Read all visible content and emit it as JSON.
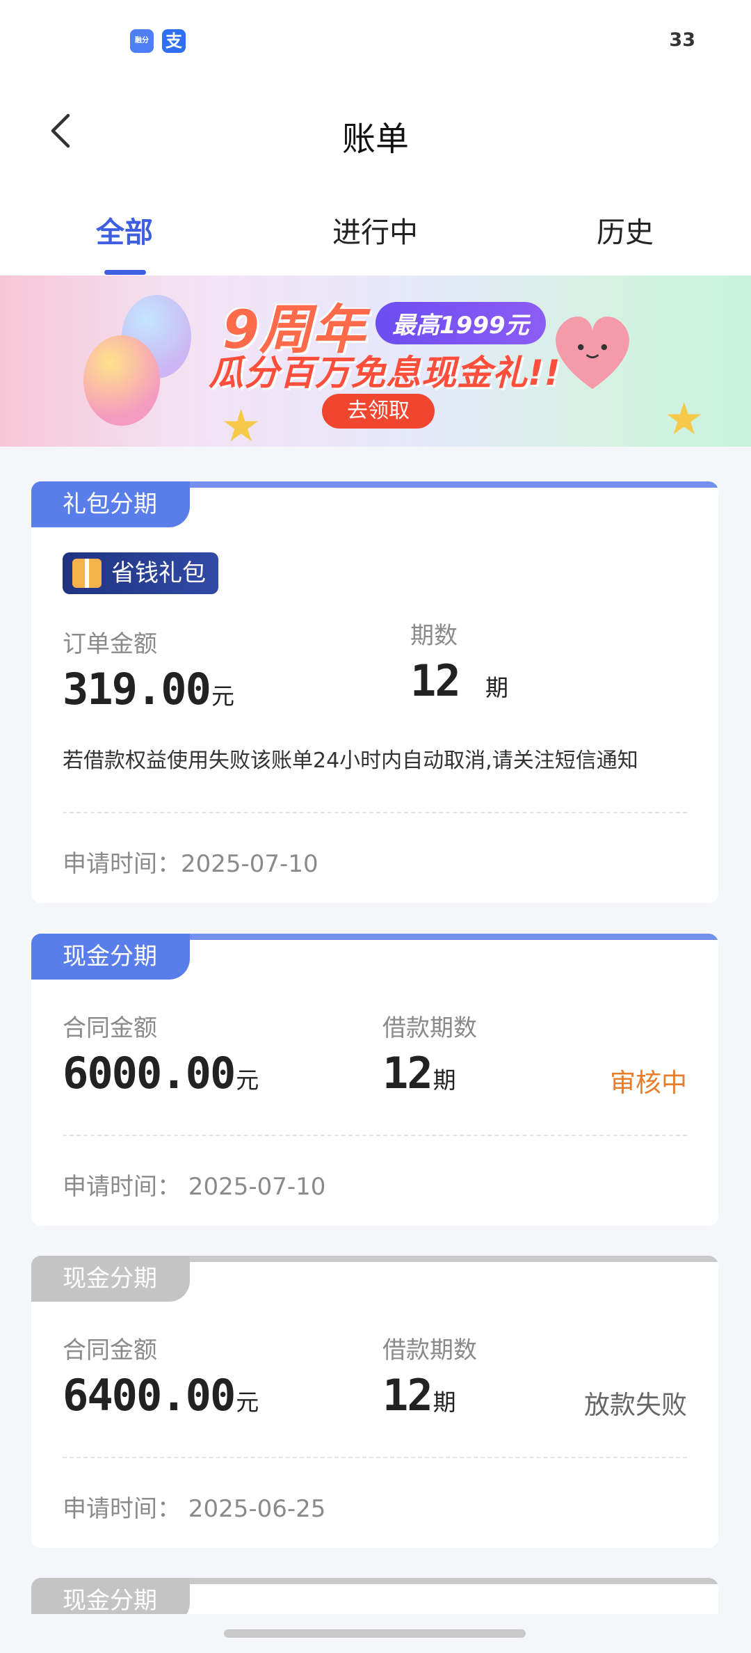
{
  "status_bar": {
    "icon1": "融分",
    "icon2": "支",
    "time": "33"
  },
  "header": {
    "title": "账单"
  },
  "tabs": [
    {
      "label": "全部"
    },
    {
      "label": "进行中"
    },
    {
      "label": "历史"
    }
  ],
  "banner": {
    "anniversary": "9周年",
    "max_amount": "最高1999元",
    "headline": "瓜分百万免息现金礼!!",
    "button": "去领取"
  },
  "cards": [
    {
      "tag": "礼包分期",
      "badge": "省钱礼包",
      "amount_label": "订单金额",
      "amount": "319.00",
      "amount_unit": "元",
      "terms_label": "期数",
      "terms": "12",
      "terms_unit": "期",
      "note": "若借款权益使用失败该账单24小时内自动取消,请关注短信通知",
      "date_text": "申请时间：2025-07-10"
    },
    {
      "tag": "现金分期",
      "amount_label": "合同金额",
      "amount": "6000.00",
      "amount_unit": "元",
      "terms_label": "借款期数",
      "terms": "12",
      "terms_unit": "期",
      "status": "审核中",
      "date_text": "申请时间：  2025-07-10"
    },
    {
      "tag": "现金分期",
      "amount_label": "合同金额",
      "amount": "6400.00",
      "amount_unit": "元",
      "terms_label": "借款期数",
      "terms": "12",
      "terms_unit": "期",
      "status": "放款失败",
      "date_text": "申请时间：  2025-06-25"
    },
    {
      "tag": "现金分期"
    }
  ],
  "colors": {
    "accent": "#3d5fe0",
    "pending": "#e87d2c",
    "failed": "#666666"
  }
}
